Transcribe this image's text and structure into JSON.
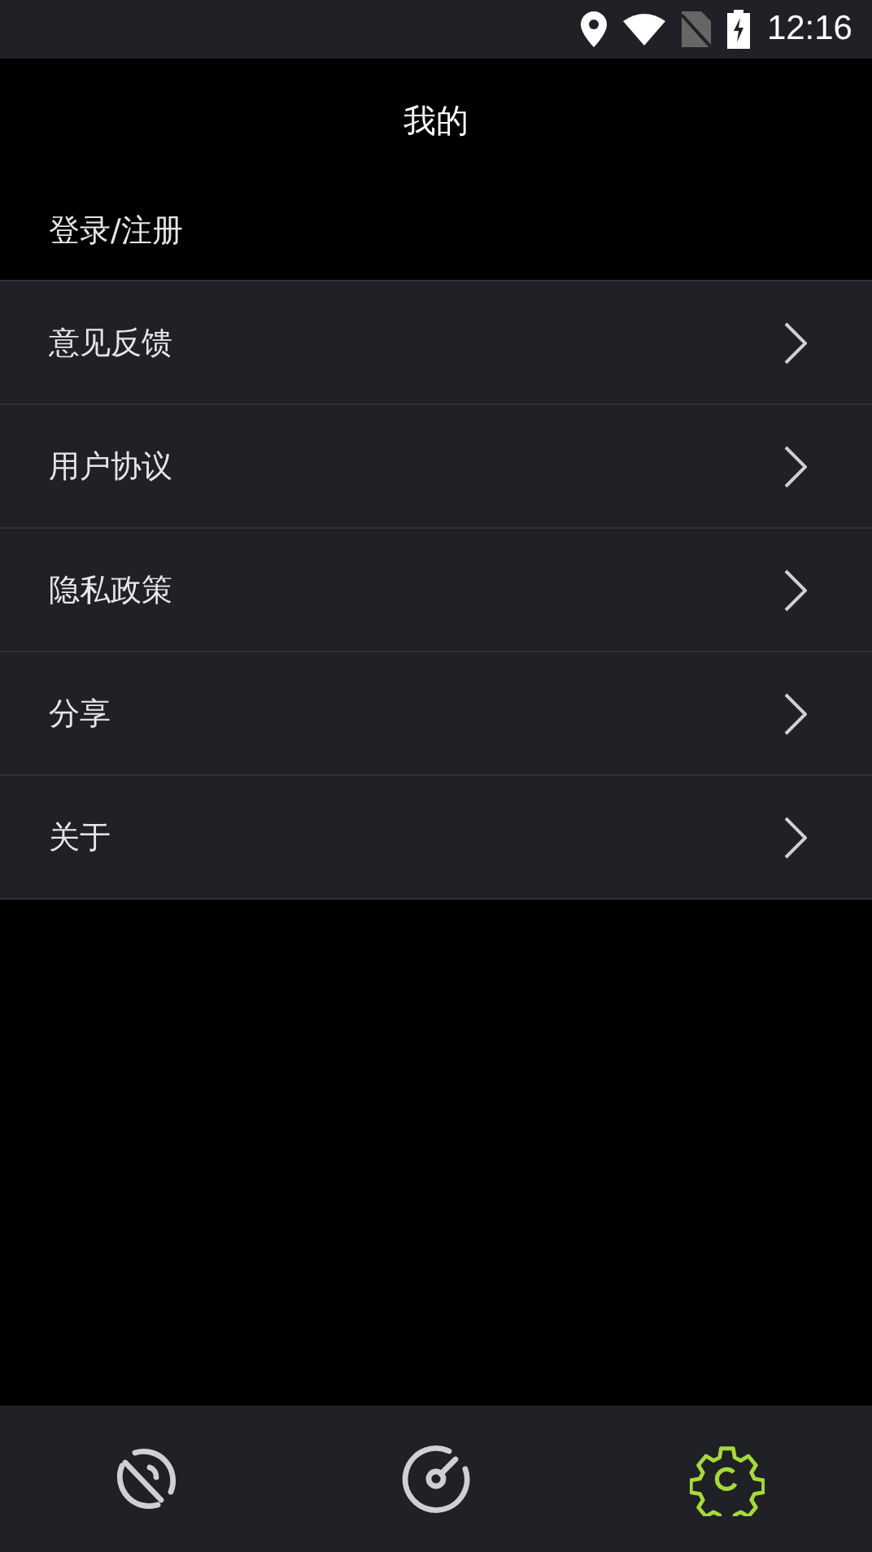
{
  "status_bar": {
    "time": "12:16"
  },
  "header": {
    "title": "我的"
  },
  "login": {
    "label": "登录/注册"
  },
  "menu": [
    {
      "label": "意见反馈"
    },
    {
      "label": "用户协议"
    },
    {
      "label": "隐私政策"
    },
    {
      "label": "分享"
    },
    {
      "label": "关于"
    }
  ],
  "bottom_nav": [
    {
      "kind": "dish",
      "selected": false
    },
    {
      "kind": "gauge",
      "selected": false
    },
    {
      "kind": "gear",
      "selected": true
    }
  ]
}
